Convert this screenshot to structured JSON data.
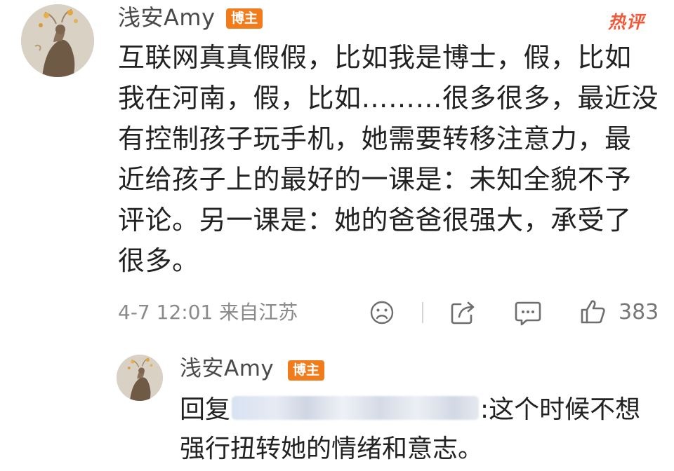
{
  "comment": {
    "author": "浅安Amy",
    "badge": "博主",
    "hot_label": "热评",
    "lines": [
      "互联网真真假假，比如我是博士，假，比如",
      "我在河南，假，比如………很多很多，最近没",
      "有控制孩子玩手机，她需要转移注意力，最",
      "近给孩子上的最好的一课是：未知全貌不予",
      "评论。另一课是：她的爸爸很强大，承受了",
      "很多。"
    ],
    "meta": "4-7 12:01 来自江苏",
    "like_count": "383"
  },
  "reply": {
    "author": "浅安Amy",
    "badge": "博主",
    "prefix": "回复",
    "line1_suffix": ":这个时候不想",
    "line2": "强行扭转她的情绪和意志。"
  },
  "icons": {
    "dislike": "sad-face-icon",
    "share": "share-icon",
    "comment": "comment-icon",
    "like": "thumbs-up-icon"
  },
  "colors": {
    "badge": "#f07c1c",
    "hot": "#f05a3a",
    "text": "#222222",
    "meta": "#8a8a8a"
  }
}
